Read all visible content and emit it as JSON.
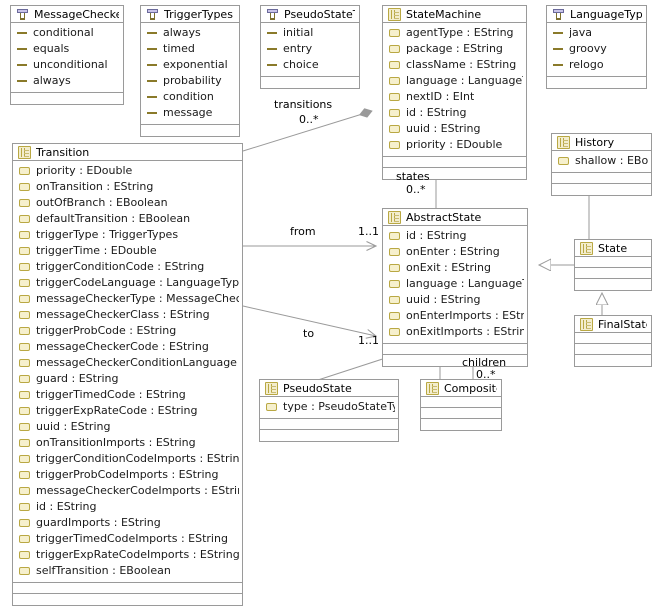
{
  "diagram": {
    "kind": "uml-class-diagram",
    "classes": [
      {
        "id": "MessageCheckerTypes",
        "name": "MessageCheckerTypes",
        "stereotype": "enumeration",
        "literals": [
          "conditional",
          "equals",
          "unconditional",
          "always"
        ],
        "empty_compartments": 1
      },
      {
        "id": "TriggerTypes",
        "name": "TriggerTypes",
        "stereotype": "enumeration",
        "literals": [
          "always",
          "timed",
          "exponential",
          "probability",
          "condition",
          "message"
        ],
        "empty_compartments": 1
      },
      {
        "id": "PseudoStateTypes",
        "name": "PseudoStateTypes",
        "stereotype": "enumeration",
        "literals": [
          "initial",
          "entry",
          "choice"
        ],
        "empty_compartments": 1
      },
      {
        "id": "StateMachine",
        "name": "StateMachine",
        "stereotype": "class",
        "attributes": [
          "agentType : EString",
          "package : EString",
          "className : EString",
          "language : LanguageTypes",
          "nextID : EInt",
          "id : EString",
          "uuid : EString",
          "priority : EDouble"
        ],
        "empty_compartments": 2
      },
      {
        "id": "LanguageTypes",
        "name": "LanguageTypes",
        "stereotype": "enumeration",
        "literals": [
          "java",
          "groovy",
          "relogo"
        ],
        "empty_compartments": 1
      },
      {
        "id": "History",
        "name": "History",
        "stereotype": "class",
        "attributes": [
          "shallow : EBoolean"
        ],
        "empty_compartments": 2
      },
      {
        "id": "Transition",
        "name": "Transition",
        "stereotype": "class",
        "attributes": [
          "priority : EDouble",
          "onTransition : EString",
          "outOfBranch : EBoolean",
          "defaultTransition : EBoolean",
          "triggerType : TriggerTypes",
          "triggerTime : EDouble",
          "triggerConditionCode : EString",
          "triggerCodeLanguage : LanguageTypes",
          "messageCheckerType : MessageCheckerTy...",
          "messageCheckerClass : EString",
          "triggerProbCode : EString",
          "messageCheckerCode : EString",
          "messageCheckerConditionLanguage : Lang...",
          "guard : EString",
          "triggerTimedCode : EString",
          "triggerExpRateCode : EString",
          "uuid : EString",
          "onTransitionImports : EString",
          "triggerConditionCodeImports : EString",
          "triggerProbCodeImports : EString",
          "messageCheckerCodeImports : EString",
          "id : EString",
          "guardImports : EString",
          "triggerTimedCodeImports : EString",
          "triggerExpRateCodeImports : EString",
          "selfTransition : EBoolean"
        ],
        "empty_compartments": 2
      },
      {
        "id": "AbstractState",
        "name": "AbstractState",
        "stereotype": "class",
        "attributes": [
          "id : EString",
          "onEnter : EString",
          "onExit : EString",
          "language : LanguageTypes",
          "uuid : EString",
          "onEnterImports : EString",
          "onExitImports : EString"
        ],
        "empty_compartments": 2
      },
      {
        "id": "State",
        "name": "State",
        "stereotype": "class",
        "attributes": [],
        "empty_compartments": 3
      },
      {
        "id": "FinalState",
        "name": "FinalState",
        "stereotype": "class",
        "attributes": [],
        "empty_compartments": 3
      },
      {
        "id": "PseudoState",
        "name": "PseudoState",
        "stereotype": "class",
        "attributes": [
          "type : PseudoStateTypes"
        ],
        "empty_compartments": 2
      },
      {
        "id": "CompositeState",
        "name": "CompositeState",
        "stereotype": "class",
        "attributes": [],
        "empty_compartments": 3
      }
    ],
    "associations": [
      {
        "id": "transitions",
        "label": "transitions",
        "multiplicity": "0..*",
        "source": "StateMachine",
        "target": "Transition",
        "type": "aggregation"
      },
      {
        "id": "states",
        "label": "states",
        "multiplicity": "0..*",
        "source": "StateMachine",
        "target": "AbstractState",
        "type": "aggregation"
      },
      {
        "id": "from",
        "label": "from",
        "multiplicity": "1..1",
        "source": "Transition",
        "target": "AbstractState",
        "type": "association"
      },
      {
        "id": "to",
        "label": "to",
        "multiplicity": "1..1",
        "source": "Transition",
        "target": "AbstractState",
        "type": "association"
      },
      {
        "id": "children",
        "label": "children",
        "multiplicity": "0..*",
        "source": "CompositeState",
        "target": "AbstractState",
        "type": "aggregation"
      }
    ],
    "generalizations": [
      {
        "sub": "State",
        "super": "AbstractState"
      },
      {
        "sub": "FinalState",
        "super": "State"
      },
      {
        "sub": "History",
        "super": "State"
      },
      {
        "sub": "PseudoState",
        "super": "AbstractState"
      },
      {
        "sub": "CompositeState",
        "super": "AbstractState"
      }
    ],
    "colors": {
      "border": "#9a9a9a",
      "background": "#ffffff",
      "text": "#000000",
      "icon_class_fill": "#f3edcd",
      "icon_class_stroke": "#b9a843",
      "edge": "#9a9a9a"
    }
  }
}
